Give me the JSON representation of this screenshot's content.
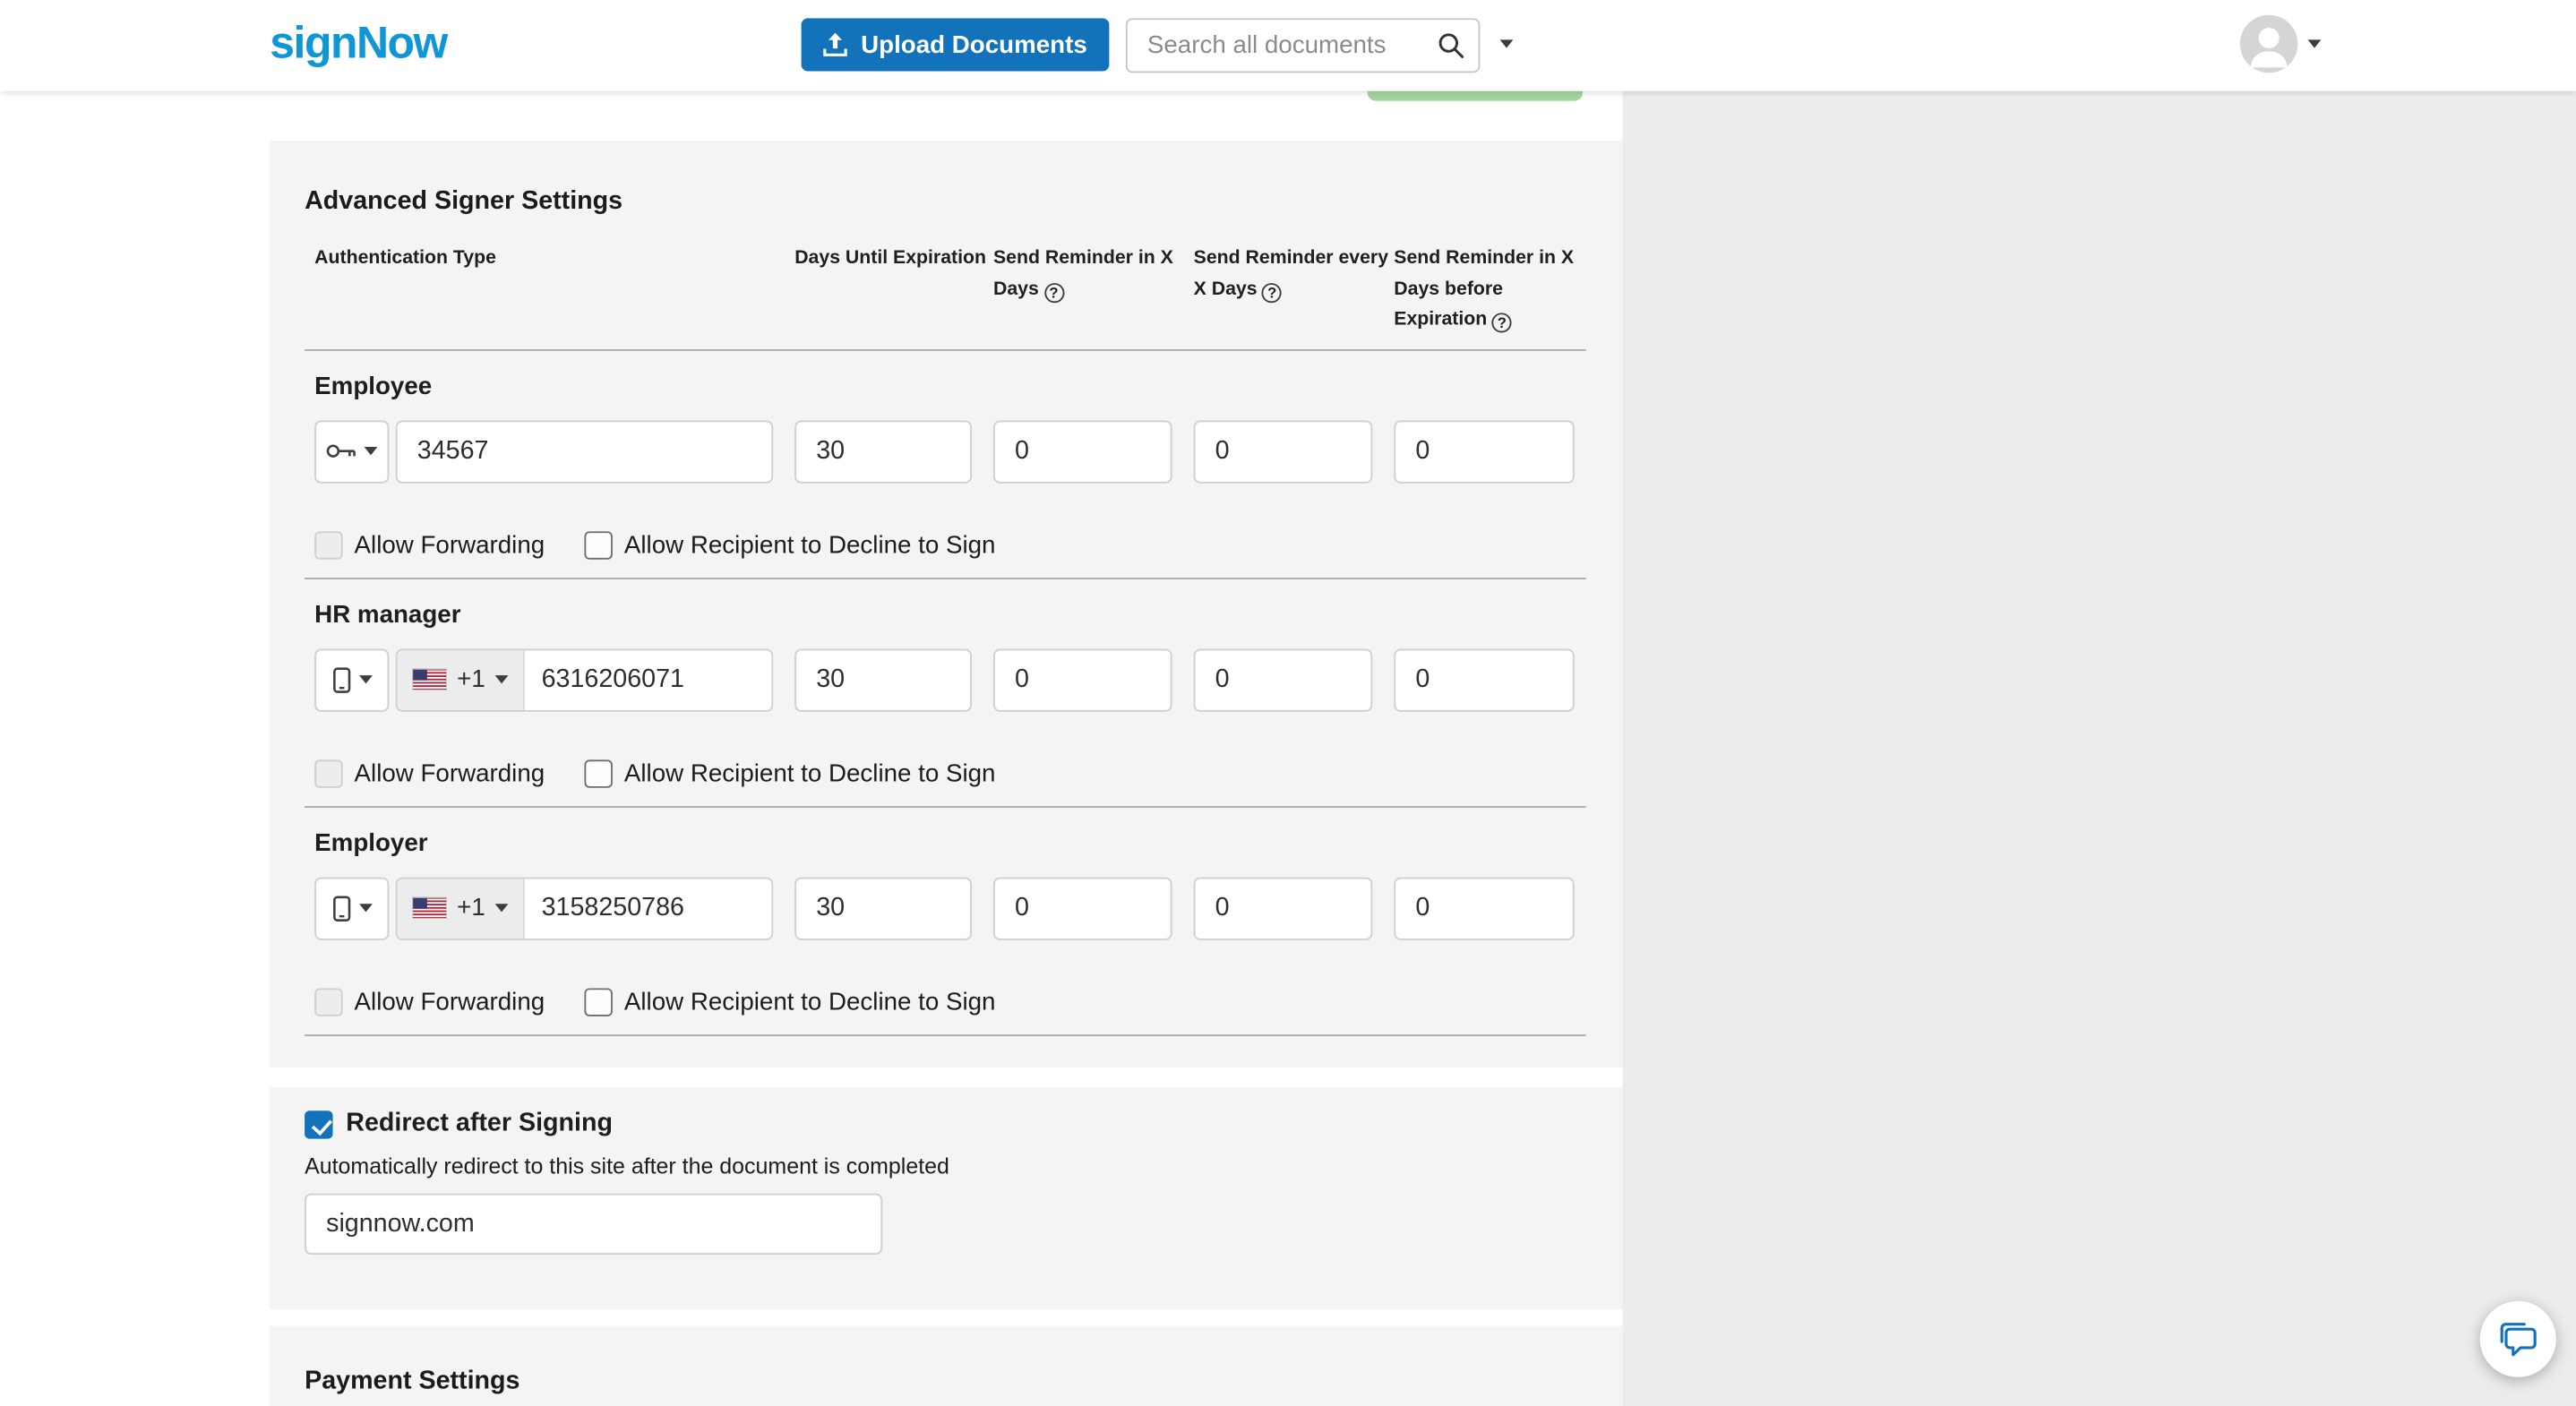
{
  "header": {
    "logo": "signNow",
    "upload_button": "Upload Documents",
    "search_placeholder": "Search all documents"
  },
  "icons": {
    "help": "?"
  },
  "colors": {
    "logo_blue": "#0f97d5",
    "primary_blue": "#1273bb",
    "partial_green_button": "#a3d69f",
    "panel_gray": "#f4f4f4",
    "side_pane_gray": "#ececec"
  },
  "advanced": {
    "title": "Advanced Signer Settings",
    "columns": {
      "auth": "Authentication Type",
      "expiration": "Days Until Expiration",
      "reminder_in": "Send Reminder in X Days",
      "reminder_every": "Send Reminder every X Days",
      "reminder_before": "Send Reminder in X Days before Expiration"
    },
    "allow_forwarding": "Allow Forwarding",
    "allow_decline": "Allow Recipient to Decline to Sign",
    "rows": [
      {
        "name": "Employee",
        "auth_method": "password",
        "value": "34567",
        "days_until_expiration": "30",
        "reminder_in": "0",
        "reminder_every": "0",
        "reminder_before": "0"
      },
      {
        "name": "HR manager",
        "auth_method": "phone",
        "country_code": "+1",
        "value": "6316206071",
        "days_until_expiration": "30",
        "reminder_in": "0",
        "reminder_every": "0",
        "reminder_before": "0"
      },
      {
        "name": "Employer",
        "auth_method": "phone",
        "country_code": "+1",
        "value": "3158250786",
        "days_until_expiration": "30",
        "reminder_in": "0",
        "reminder_every": "0",
        "reminder_before": "0"
      }
    ]
  },
  "redirect": {
    "label": "Redirect after Signing",
    "checked": true,
    "helper": "Automatically redirect to this site after the document is completed",
    "value": "signnow.com"
  },
  "payment": {
    "title": "Payment Settings"
  }
}
